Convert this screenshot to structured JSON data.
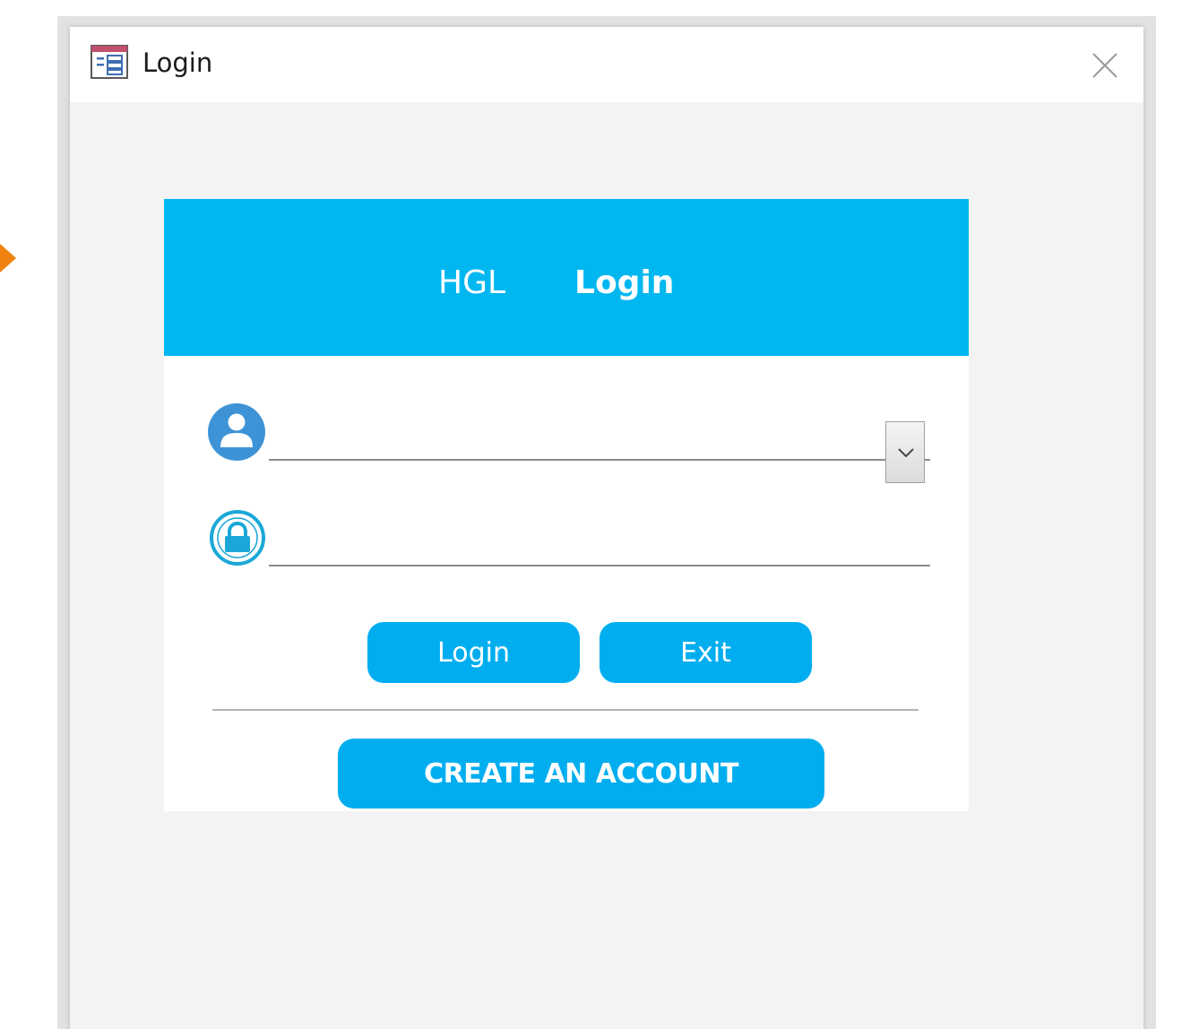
{
  "window": {
    "title": "Login"
  },
  "header": {
    "brand": "HGL",
    "title": "Login"
  },
  "form": {
    "username_value": "",
    "password_value": ""
  },
  "buttons": {
    "login": "Login",
    "exit": "Exit",
    "create_account": "CREATE AN ACCOUNT"
  },
  "colors": {
    "accent": "#00b7f0",
    "button": "#00aef0",
    "user_icon": "#3d93d6",
    "side_marker": "#f0820f"
  },
  "icons": {
    "window": "form-icon",
    "close": "close-icon",
    "user": "user-icon",
    "lock": "lock-icon",
    "dropdown": "chevron-down-icon"
  }
}
